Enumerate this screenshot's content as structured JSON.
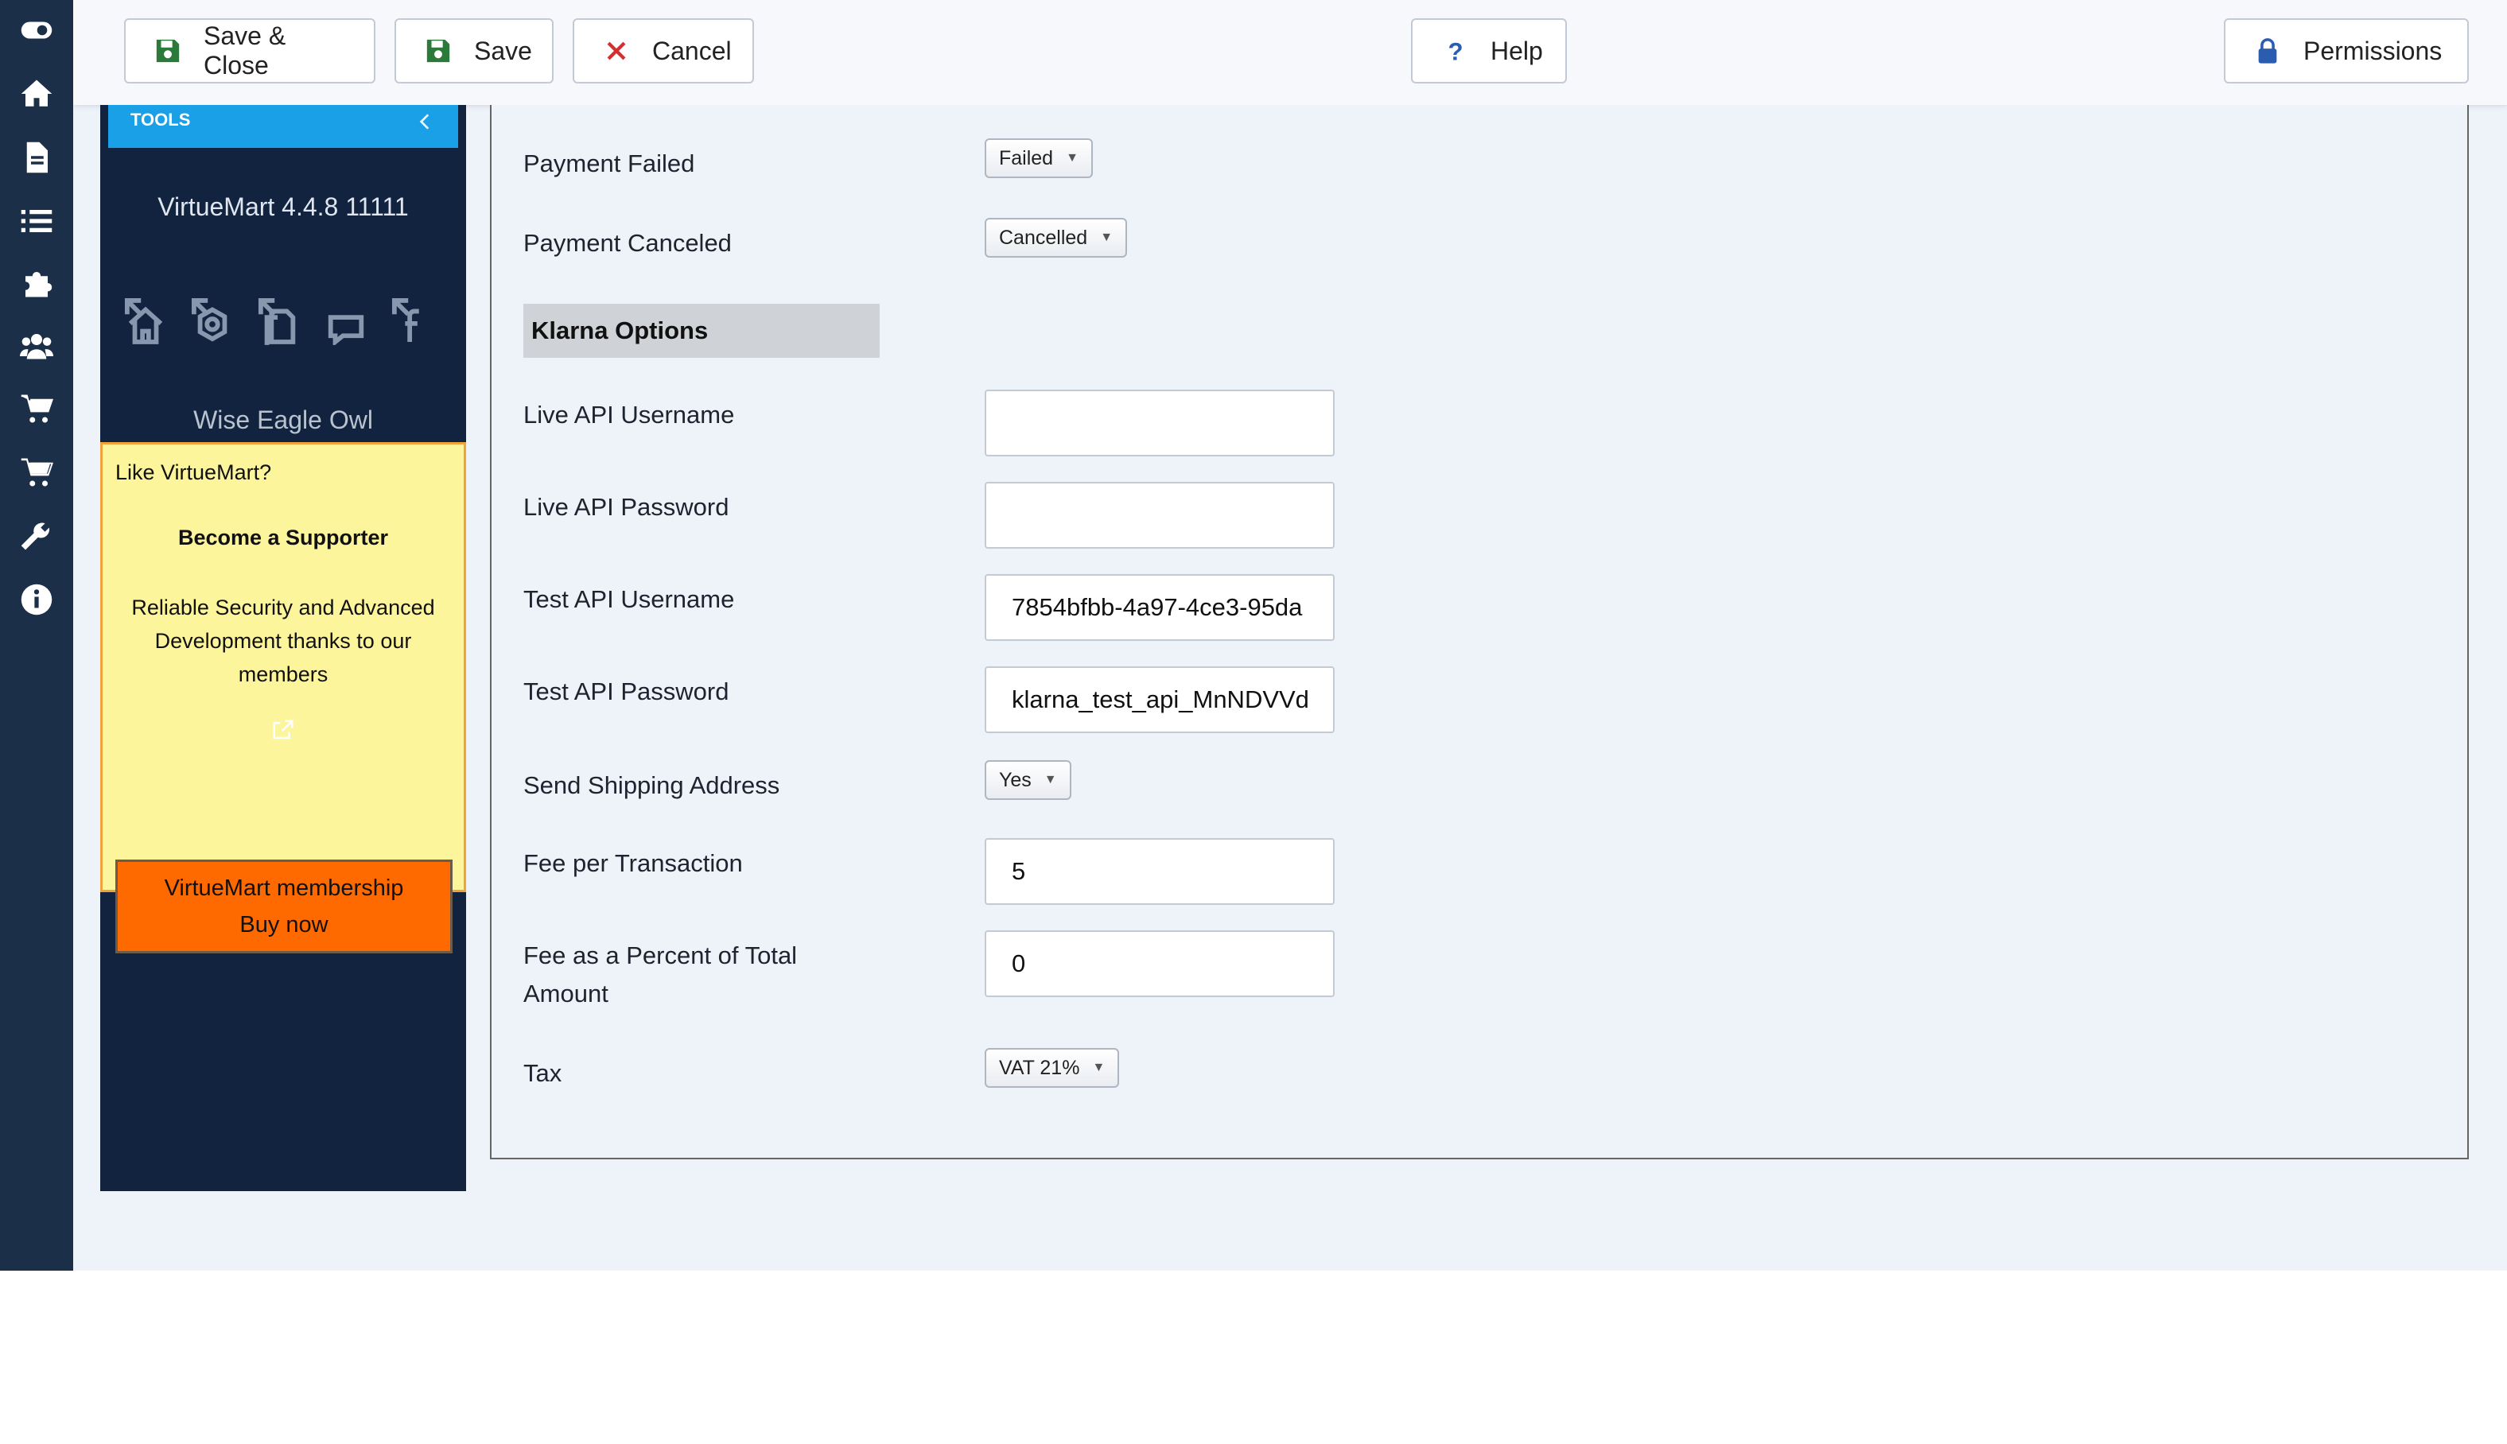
{
  "toolbar": {
    "save_close": "Save & Close",
    "save": "Save",
    "cancel": "Cancel",
    "help": "Help",
    "permissions": "Permissions"
  },
  "rail": {
    "icons": [
      "toggle-icon",
      "home-icon",
      "document-icon",
      "list-icon",
      "puzzle-icon",
      "users-icon",
      "cart-icon",
      "cart-icon",
      "wrench-icon",
      "info-icon"
    ]
  },
  "sidebar": {
    "tools_label": "TOOLS",
    "version": "VirtueMart 4.4.8 11111",
    "link_icons": [
      "home-link-icon",
      "settings-link-icon",
      "docs-link-icon",
      "forum-link-icon",
      "facebook-link-icon"
    ],
    "owl_text": "Wise Eagle Owl",
    "promo": {
      "like": "Like VirtueMart?",
      "become": "Become a Supporter",
      "reliable": "Reliable Security and Advanced Development thanks to our members",
      "buy_line1": "VirtueMart membership",
      "buy_line2": "Buy now"
    }
  },
  "form": {
    "payment_failed": {
      "label": "Payment Failed",
      "value": "Failed"
    },
    "payment_canceled": {
      "label": "Payment Canceled",
      "value": "Cancelled"
    },
    "section_title": "Klarna Options",
    "live_api_username": {
      "label": "Live API Username",
      "value": ""
    },
    "live_api_password": {
      "label": "Live API Password",
      "value": ""
    },
    "test_api_username": {
      "label": "Test API Username",
      "value": "7854bfbb-4a97-4ce3-95da"
    },
    "test_api_password": {
      "label": "Test API Password",
      "value": "klarna_test_api_MnNDVVd"
    },
    "send_shipping": {
      "label": "Send Shipping Address",
      "value": "Yes"
    },
    "fee_per_transaction": {
      "label": "Fee per Transaction",
      "value": "5"
    },
    "fee_percent": {
      "label_line1": "Fee as a Percent of Total",
      "label_line2": "Amount",
      "value": "0"
    },
    "tax": {
      "label": "Tax",
      "value": "VAT 21%"
    }
  },
  "colors": {
    "rail_bg": "#1c2f49",
    "sidebar_bg": "#12233f",
    "tools_bar": "#1aa0e6",
    "promo_bg": "#fdf59c",
    "buy_button": "#ff6a00",
    "save_icon": "#2c7a3a",
    "cancel_icon": "#d32f2f",
    "blue_icon": "#2a5db0"
  }
}
